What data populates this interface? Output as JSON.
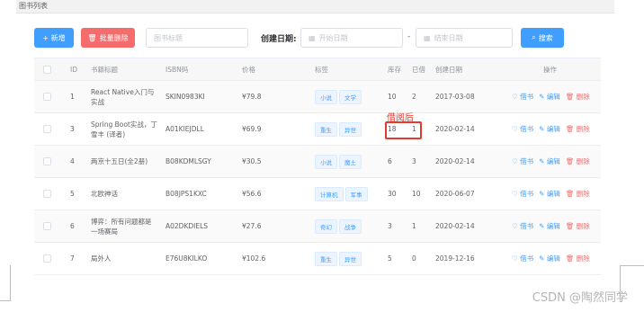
{
  "header": {
    "title": "图书列表"
  },
  "toolbar": {
    "add_label": "+ 新增",
    "batch_delete_label": "批量删除",
    "title_placeholder": "图书标题",
    "date_label": "创建日期:",
    "start_placeholder": "开始日期",
    "dash": "-",
    "end_placeholder": "结束日期",
    "search_label": "搜索"
  },
  "table": {
    "columns": [
      "ID",
      "书籍标题",
      "ISBN码",
      "价格",
      "标签",
      "库存",
      "已借",
      "创建日期",
      "操作"
    ],
    "rows": [
      {
        "id": "1",
        "title": "React Native入门与实战",
        "isbn": "SKIN0983KI",
        "price": "¥79.8",
        "tags": [
          "小说",
          "文学"
        ],
        "stock": "10",
        "borrowed": "2",
        "date": "2017-03-08"
      },
      {
        "id": "3",
        "title": "Spring Boot实战，丁雪丰 (译者)",
        "isbn": "A01KIEJDLL",
        "price": "¥69.9",
        "tags": [
          "重生",
          "异世"
        ],
        "stock": "18",
        "borrowed": "1",
        "date": "2020-02-14"
      },
      {
        "id": "4",
        "title": "两京十五日(全2册)",
        "isbn": "B08KDMLSGY",
        "price": "¥30.5",
        "tags": [
          "小说",
          "魔土"
        ],
        "stock": "6",
        "borrowed": "3",
        "date": "2020-02-14"
      },
      {
        "id": "5",
        "title": "北欧神话",
        "isbn": "B08JPS1KXC",
        "price": "¥56.6",
        "tags": [
          "计算机",
          "军事"
        ],
        "stock": "30",
        "borrowed": "10",
        "date": "2020-06-07"
      },
      {
        "id": "6",
        "title": "博弈：所有问题都是一场赛局",
        "isbn": "A02DKDIELS",
        "price": "¥27.6",
        "tags": [
          "奇幻",
          "战争"
        ],
        "stock": "3",
        "borrowed": "1",
        "date": "2020-02-14"
      },
      {
        "id": "7",
        "title": "局外人",
        "isbn": "E76U8KILKO",
        "price": "¥102.6",
        "tags": [
          "重生",
          "异世"
        ],
        "stock": "5",
        "borrowed": "0",
        "date": "2019-12-16"
      }
    ],
    "ops": {
      "borrow": "借书",
      "edit": "编辑",
      "delete": "删除"
    }
  },
  "annotation": {
    "text": "借阅后"
  },
  "watermark": "CSDN @陶然同学",
  "colors": {
    "primary": "#409eff",
    "danger": "#f56c6c",
    "annotation": "#e23a2e"
  }
}
